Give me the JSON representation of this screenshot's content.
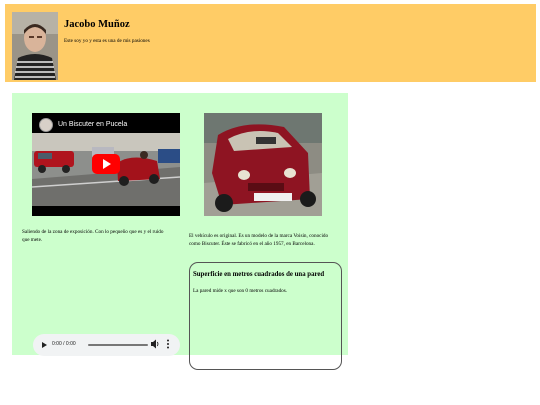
{
  "header": {
    "title": "Jacobo Muñoz",
    "subtitle": "Este soy yo y esta es una de mis pasiones",
    "avatar_icon": "person-photo-icon"
  },
  "video": {
    "title": "Un Biscuter en Pucela",
    "play_icon": "youtube-play-icon",
    "caption": "Saliendo de la zona de exposición. Con lo pequeño que es y el ruido que mete."
  },
  "photo": {
    "icon": "red-car-photo-icon",
    "caption": "El vehículo es original. Es un modelo de la marca Voisin, conocido como Biscuter. Éste se fabricó en el año 1957, en Barcelona."
  },
  "wall": {
    "title": "Superficie en metros cuadrados de una pared",
    "text": "La pared mide x que son 0 metros cuadrados."
  },
  "audio": {
    "time": "0:00 / 0:00",
    "progress": 0,
    "play_icon": "play-icon",
    "volume_icon": "volume-icon",
    "menu_icon": "more-vert-icon"
  },
  "colors": {
    "header_bg": "#ffcc66",
    "main_bg": "#ccffcc",
    "youtube_red": "#ff0000"
  }
}
